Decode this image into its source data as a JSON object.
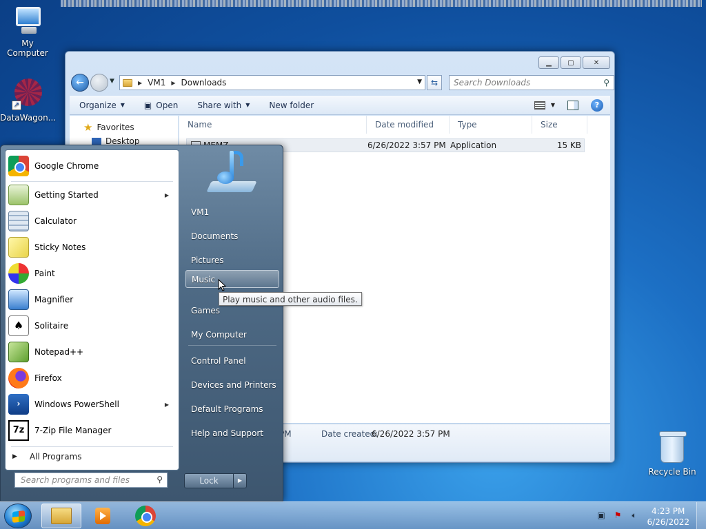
{
  "desktop": {
    "icons": [
      {
        "label": "My Computer"
      },
      {
        "label": "DataWagon..."
      },
      {
        "label": "Recycle Bin"
      }
    ]
  },
  "explorer": {
    "breadcrumb": [
      "VM1",
      "Downloads"
    ],
    "search_placeholder": "Search Downloads",
    "toolbar": {
      "organize": "Organize",
      "open": "Open",
      "share_with": "Share with",
      "new_folder": "New folder"
    },
    "nav_pane": {
      "favorites": "Favorites",
      "desktop": "Desktop"
    },
    "columns": [
      "Name",
      "Date modified",
      "Type",
      "Size"
    ],
    "files": [
      {
        "name": "MEMZ",
        "date_modified": "6/26/2022 3:57 PM",
        "type": "Application",
        "size": "15 KB"
      }
    ],
    "details": {
      "time_fragment": "PM",
      "date_created_label": "Date created:",
      "date_created_value": "6/26/2022 3:57 PM"
    }
  },
  "start_menu": {
    "programs": [
      {
        "label": "Google Chrome",
        "icon": "chrome-icon",
        "submenu": false
      },
      {
        "label": "Getting Started",
        "icon": "getting-started-icon",
        "submenu": true
      },
      {
        "label": "Calculator",
        "icon": "calculator-icon",
        "submenu": false
      },
      {
        "label": "Sticky Notes",
        "icon": "sticky-notes-icon",
        "submenu": false
      },
      {
        "label": "Paint",
        "icon": "paint-icon",
        "submenu": false
      },
      {
        "label": "Magnifier",
        "icon": "magnifier-icon",
        "submenu": false
      },
      {
        "label": "Solitaire",
        "icon": "solitaire-icon",
        "submenu": false
      },
      {
        "label": "Notepad++",
        "icon": "notepadpp-icon",
        "submenu": false
      },
      {
        "label": "Firefox",
        "icon": "firefox-icon",
        "submenu": false
      },
      {
        "label": "Windows PowerShell",
        "icon": "powershell-icon",
        "submenu": true
      },
      {
        "label": "7-Zip File Manager",
        "icon": "sevenzip-icon",
        "submenu": false
      }
    ],
    "all_programs": "All Programs",
    "search_placeholder": "Search programs and files",
    "right_links": [
      {
        "label": "VM1"
      },
      {
        "label": "Documents"
      },
      {
        "label": "Pictures"
      },
      {
        "label": "Music"
      },
      {
        "label": "Games"
      },
      {
        "label": "My Computer"
      },
      {
        "label": "Control Panel"
      },
      {
        "label": "Devices and Printers"
      },
      {
        "label": "Default Programs"
      },
      {
        "label": "Help and Support"
      }
    ],
    "tooltip": "Play music and other audio files.",
    "lock_label": "Lock"
  },
  "taskbar": {
    "time": "4:23 PM",
    "date": "6/26/2022"
  }
}
